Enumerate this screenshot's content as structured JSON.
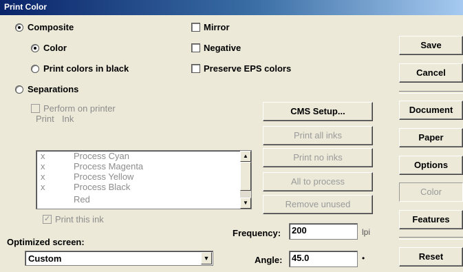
{
  "window": {
    "title": "Print Color"
  },
  "output_mode": {
    "composite_label": "Composite",
    "color_label": "Color",
    "print_black_label": "Print colors in black",
    "separations_label": "Separations"
  },
  "options": {
    "mirror_label": "Mirror",
    "negative_label": "Negative",
    "preserve_eps_label": "Preserve EPS colors"
  },
  "separations": {
    "perform_on_printer_label": "Perform on printer",
    "col_print": "Print",
    "col_ink": "Ink",
    "inks": [
      {
        "print": "x",
        "ink": "Process Cyan"
      },
      {
        "print": "x",
        "ink": "Process Magenta"
      },
      {
        "print": "x",
        "ink": "Process Yellow"
      },
      {
        "print": "x",
        "ink": "Process Black"
      },
      {
        "print": "",
        "ink": "Red"
      }
    ],
    "print_this_ink_label": "Print this ink"
  },
  "center_buttons": {
    "cms_setup": "CMS Setup...",
    "print_all_inks": "Print all inks",
    "print_no_inks": "Print no inks",
    "all_to_process": "All to process",
    "remove_unused": "Remove unused"
  },
  "screen": {
    "optimized_label": "Optimized screen:",
    "optimized_value": "Custom",
    "frequency_label": "Frequency:",
    "frequency_value": "200",
    "frequency_unit": "lpi",
    "angle_label": "Angle:",
    "angle_value": "45.0",
    "angle_unit": "•"
  },
  "right_buttons": {
    "save": "Save",
    "cancel": "Cancel",
    "document": "Document",
    "paper": "Paper",
    "options": "Options",
    "color": "Color",
    "features": "Features",
    "reset": "Reset"
  }
}
